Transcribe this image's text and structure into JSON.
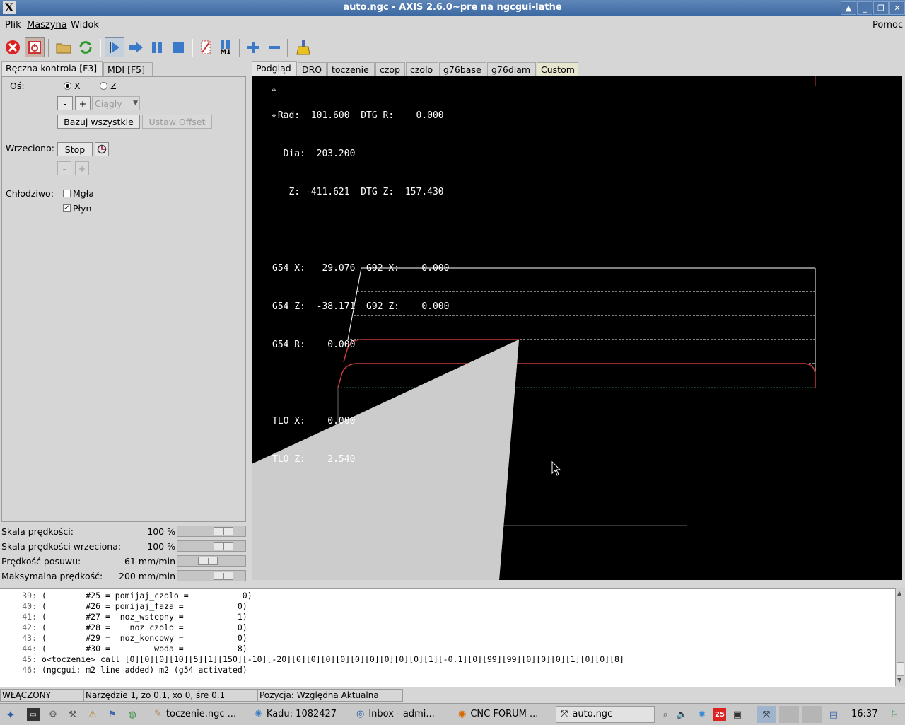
{
  "window": {
    "title": "auto.ngc - AXIS 2.6.0~pre na ngcgui-lathe",
    "x_logo": "X"
  },
  "menu": {
    "items": [
      "Plik",
      "Maszyna",
      "Widok"
    ],
    "help": "Pomoc"
  },
  "toolbar": {
    "icons": [
      "estop-icon",
      "power-icon",
      "open-file-icon",
      "reload-icon",
      "run-icon",
      "step-icon",
      "pause-icon",
      "stop-icon",
      "block-delete-icon",
      "optional-stop-icon",
      "zoom-in-icon",
      "zoom-out-icon",
      "clear-plot-icon"
    ],
    "optional_stop_label": "M1"
  },
  "left_tabs": [
    "Ręczna kontrola [F3]",
    "MDI [F5]"
  ],
  "manual": {
    "axis_label": "Oś:",
    "axis_x": "X",
    "axis_z": "Z",
    "axis_selected": "X",
    "minus": "-",
    "plus": "+",
    "jog_mode": "Ciągły",
    "home_all": "Bazuj wszystkie",
    "set_offset": "Ustaw Offset",
    "spindle_label": "Wrzeciono:",
    "spindle_stop": "Stop",
    "coolant_label": "Chłodziwo:",
    "mist": "Mgła",
    "flood": "Płyn",
    "mist_checked": false,
    "flood_checked": true
  },
  "sliders": [
    {
      "label": "Skala prędkości:",
      "value": "100 %",
      "level": 0.75
    },
    {
      "label": "Skala prędkości wrzeciona:",
      "value": "100 %",
      "level": 0.75
    },
    {
      "label": "Prędkość posuwu:",
      "value": "61 mm/min",
      "level": 0.43
    },
    {
      "label": "Maksymalna prędkość:",
      "value": "200 mm/min",
      "level": 0.75
    }
  ],
  "right_tabs": [
    "Podgląd",
    "DRO",
    "toczenie",
    "czop",
    "czolo",
    "g76base",
    "g76diam",
    "Custom"
  ],
  "dro": {
    "lines": [
      " Rad:  101.600  DTG R:    0.000",
      "  Dia:  203.200",
      "   Z: -411.621  DTG Z:  157.430",
      "",
      "G54 X:   29.076  G92 X:    0.000",
      "G54 Z:  -38.171  G92 Z:    0.000",
      "G54 R:    0.000",
      "",
      "TLO X:    0.000",
      "TLO Z:    2.540"
    ]
  },
  "gcode": {
    "lines": [
      {
        "num": "39:",
        "text": "(        #25 = pomijaj_czolo =           0)"
      },
      {
        "num": "40:",
        "text": "(        #26 = pomijaj_faza =           0)"
      },
      {
        "num": "41:",
        "text": "(        #27 =  noz_wstepny =           1)"
      },
      {
        "num": "42:",
        "text": "(        #28 =    noz_czolo =           0)"
      },
      {
        "num": "43:",
        "text": "(        #29 =  noz_koncowy =           0)"
      },
      {
        "num": "44:",
        "text": "(        #30 =         woda =           8)"
      },
      {
        "num": "45:",
        "text": "o<toczenie> call [0][0][0][10][5][1][150][-10][-20][0][0][0][0][0][0][0][0][0][1][-0.1][0][99][99][0][0][0][1][0][0][8]"
      },
      {
        "num": "46:",
        "text": "(ngcgui: m2 line added) m2 (g54 activated)"
      }
    ]
  },
  "status": {
    "state": "WŁĄCZONY",
    "tool": "Narzędzie 1, zo 0.1, xo 0, śre 0.1",
    "position": "Pozycja: Względna Aktualna"
  },
  "taskbar": {
    "tasks": [
      "toczenie.ngc ...",
      "Kadu: 1082427",
      "Inbox - admi...",
      "CNC FORUM ...",
      "auto.ngc"
    ],
    "calendar_day": "25",
    "clock": "16:37"
  },
  "colors": {
    "titlebar": "#3d6aa3",
    "toolpath_red": "#c83c3c",
    "preview_bg": "#000000",
    "tool_gray": "#cccccc"
  }
}
